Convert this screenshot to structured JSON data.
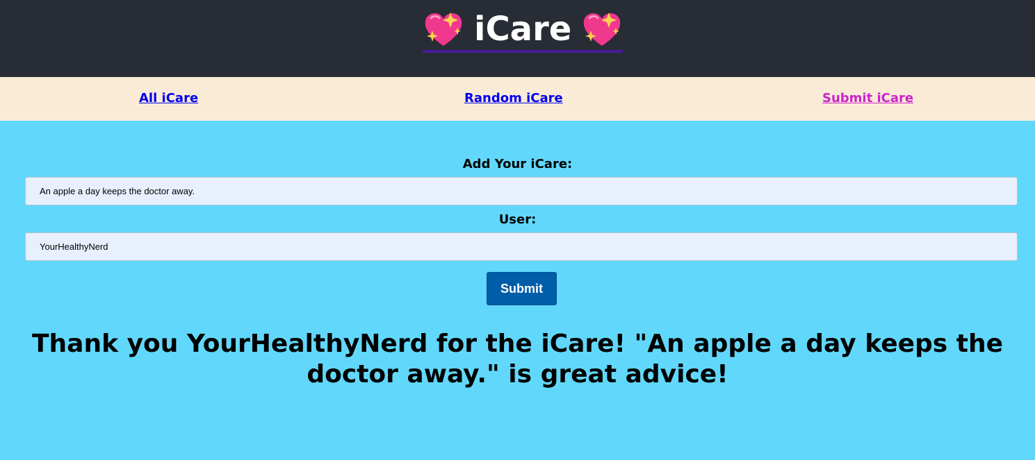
{
  "header": {
    "title": "iCare",
    "icon_left": "sparkling-heart-icon",
    "icon_right": "sparkling-heart-icon"
  },
  "nav": {
    "items": [
      {
        "label": "All iCare"
      },
      {
        "label": "Random iCare"
      },
      {
        "label": "Submit iCare"
      }
    ]
  },
  "form": {
    "icare_label": "Add Your iCare:",
    "icare_value": "An apple a day keeps the doctor away.",
    "user_label": "User:",
    "user_value": "YourHealthyNerd",
    "submit_label": "Submit"
  },
  "message": {
    "text": "Thank you YourHealthyNerd for the iCare! \"An apple a day keeps the doctor away.\" is great advice!"
  },
  "colors": {
    "header_bg": "#282c34",
    "nav_bg": "#faebd7",
    "page_bg": "#61d8fb",
    "link": "#0000ee",
    "link_visited": "#cc22cc",
    "button_bg": "#005da8"
  }
}
